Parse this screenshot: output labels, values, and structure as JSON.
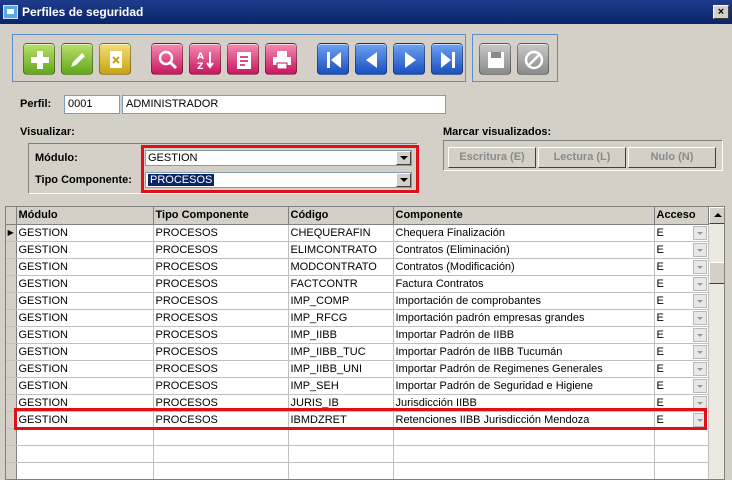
{
  "window": {
    "title": "Perfiles de seguridad",
    "close_label": "×"
  },
  "toolbar": {
    "buttons": [
      "add-icon",
      "edit-icon",
      "delete-icon",
      "search-icon",
      "sort-icon",
      "report-icon",
      "print-icon",
      "first-icon",
      "previous-icon",
      "next-icon",
      "last-icon",
      "save-icon",
      "cancel-icon"
    ]
  },
  "perfil": {
    "label": "Perfil:",
    "code": "0001",
    "name": "ADMINISTRADOR"
  },
  "visualizar": {
    "label": "Visualizar:",
    "modulo_label": "Módulo:",
    "modulo_value": "GESTION",
    "tipo_label": "Tipo Componente:",
    "tipo_value": "PROCESOS"
  },
  "marcar": {
    "label": "Marcar visualizados:",
    "escritura": "Escritura (E)",
    "lectura": "Lectura (L)",
    "nulo": "Nulo (N)"
  },
  "grid": {
    "columns": [
      "Módulo",
      "Tipo Componente",
      "Código",
      "Componente",
      "Acceso"
    ],
    "rows": [
      [
        "GESTION",
        "PROCESOS",
        "CHEQUERAFIN",
        "Chequera Finalización",
        "E"
      ],
      [
        "GESTION",
        "PROCESOS",
        "ELIMCONTRATO",
        "Contratos (Eliminación)",
        "E"
      ],
      [
        "GESTION",
        "PROCESOS",
        "MODCONTRATO",
        "Contratos (Modificación)",
        "E"
      ],
      [
        "GESTION",
        "PROCESOS",
        "FACTCONTR",
        "Factura Contratos",
        "E"
      ],
      [
        "GESTION",
        "PROCESOS",
        "IMP_COMP",
        "Importación de comprobantes",
        "E"
      ],
      [
        "GESTION",
        "PROCESOS",
        "IMP_RFCG",
        "Importación padrón empresas grandes",
        "E"
      ],
      [
        "GESTION",
        "PROCESOS",
        "IMP_IIBB",
        "Importar Padrón de IIBB",
        "E"
      ],
      [
        "GESTION",
        "PROCESOS",
        "IMP_IIBB_TUC",
        "Importar Padrón de IIBB Tucumán",
        "E"
      ],
      [
        "GESTION",
        "PROCESOS",
        "IMP_IIBB_UNI",
        "Importar Padrón de Regimenes Generales",
        "E"
      ],
      [
        "GESTION",
        "PROCESOS",
        "IMP_SEH",
        "Importar Padrón de Seguridad e Higiene",
        "E"
      ],
      [
        "GESTION",
        "PROCESOS",
        "JURIS_IB",
        "Jurisdicción IIBB",
        "E"
      ],
      [
        "GESTION",
        "PROCESOS",
        "IBMDZRET",
        "Retenciones IIBB Jurisdicción Mendoza",
        "E"
      ]
    ]
  },
  "colors": {
    "highlight_border": "#e0101b",
    "title_bar": "#0a246a",
    "selection": "#0a246a"
  }
}
